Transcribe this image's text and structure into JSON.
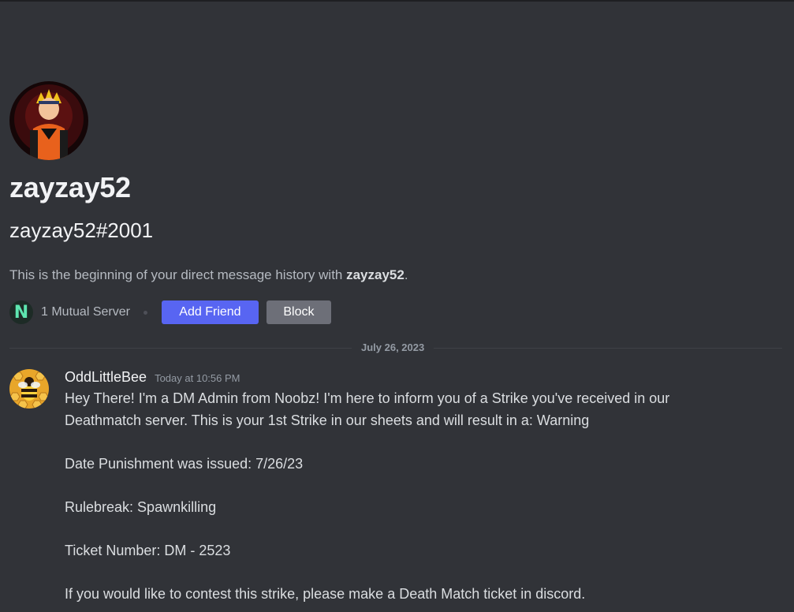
{
  "profile": {
    "display_name": "zayzay52",
    "tag": "zayzay52#2001",
    "avatar_icon": "anime-character-avatar"
  },
  "intro": {
    "prefix": "This is the beginning of your direct message history with ",
    "name": "zayzay52",
    "suffix": "."
  },
  "mutual": {
    "server_icon_letter": "N",
    "server_count_label": "1 Mutual Server"
  },
  "actions": {
    "add_friend_label": "Add Friend",
    "block_label": "Block"
  },
  "divider": {
    "date": "July 26, 2023"
  },
  "message": {
    "author": "OddLittleBee",
    "timestamp": "Today at 10:56 PM",
    "avatar_icon": "bee-avatar",
    "lines": [
      "Hey There! I'm a DM Admin from Noobz! I'm here to inform you of a Strike you've received in our",
      "Deathmatch server. This is your 1st Strike in our sheets and will result in a: Warning",
      "Date Punishment was issued: 7/26/23",
      "Rulebreak: Spawnkilling",
      "Ticket Number: DM - 2523",
      "If you would like to contest this strike, please make a Death Match ticket in discord."
    ]
  },
  "colors": {
    "background": "#313338",
    "accent": "#5865f2",
    "block_button": "#6d6f78"
  }
}
